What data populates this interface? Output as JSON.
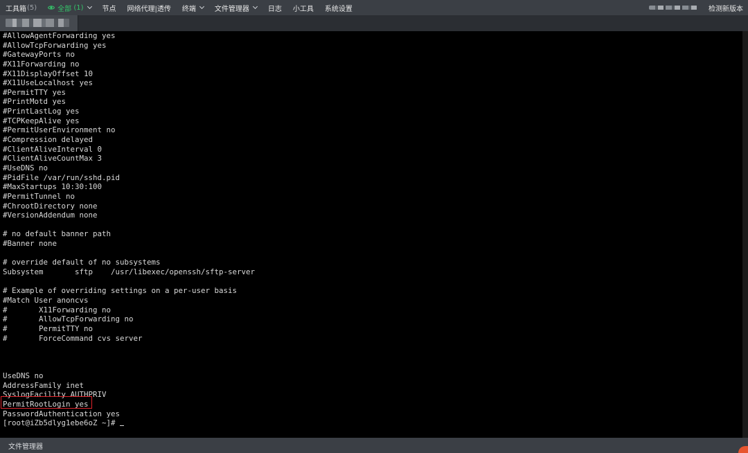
{
  "topbar": {
    "toolbox_label": "工具箱",
    "toolbox_count": "(5)",
    "all_label": "全部",
    "all_count": "(1)",
    "nodes": "节点",
    "network_proxy": "网络代理|透传",
    "terminal": "终端",
    "file_manager": "文件管理器",
    "logs": "日志",
    "tools": "小工具",
    "settings": "系统设置",
    "check_version": "检测新版本"
  },
  "terminal": {
    "lines": [
      "#AllowAgentForwarding yes",
      "#AllowTcpForwarding yes",
      "#GatewayPorts no",
      "#X11Forwarding no",
      "#X11DisplayOffset 10",
      "#X11UseLocalhost yes",
      "#PermitTTY yes",
      "#PrintMotd yes",
      "#PrintLastLog yes",
      "#TCPKeepAlive yes",
      "#PermitUserEnvironment no",
      "#Compression delayed",
      "#ClientAliveInterval 0",
      "#ClientAliveCountMax 3",
      "#UseDNS no",
      "#PidFile /var/run/sshd.pid",
      "#MaxStartups 10:30:100",
      "#PermitTunnel no",
      "#ChrootDirectory none",
      "#VersionAddendum none",
      "",
      "# no default banner path",
      "#Banner none",
      "",
      "# override default of no subsystems",
      "Subsystem       sftp    /usr/libexec/openssh/sftp-server",
      "",
      "# Example of overriding settings on a per-user basis",
      "#Match User anoncvs",
      "#       X11Forwarding no",
      "#       AllowTcpForwarding no",
      "#       PermitTTY no",
      "#       ForceCommand cvs server",
      "",
      "",
      "",
      "UseDNS no",
      "AddressFamily inet",
      "SyslogFacility AUTHPRIV",
      "PermitRootLogin yes",
      "PasswordAuthentication yes"
    ],
    "prompt": "[root@iZb5dlyg1ebe6oZ ~]# "
  },
  "bottombar": {
    "file_manager": "文件管理器"
  },
  "colors": {
    "highlight": "#e0242b",
    "active_filter": "#35c46a"
  }
}
